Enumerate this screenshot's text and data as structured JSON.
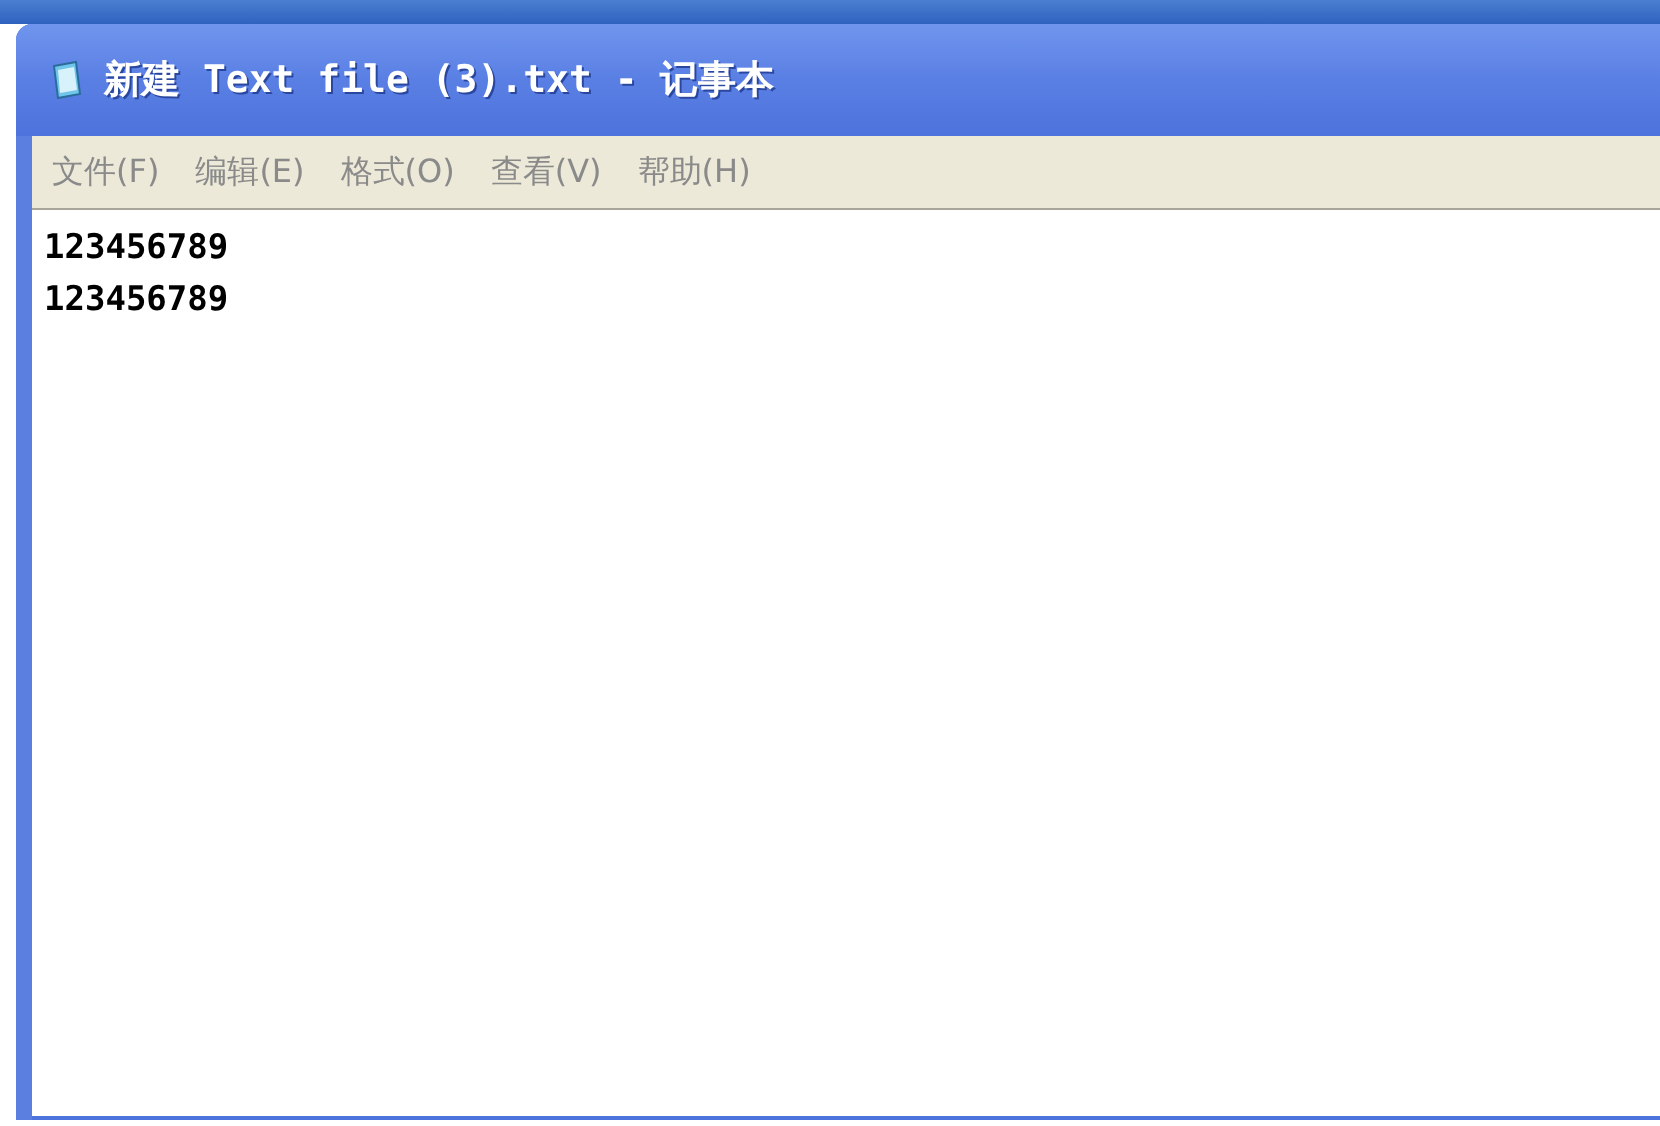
{
  "window": {
    "title": "新建 Text file (3).txt - 记事本"
  },
  "menu": [
    {
      "label": "文件(F)"
    },
    {
      "label": "编辑(E)"
    },
    {
      "label": "格式(O)"
    },
    {
      "label": "查看(V)"
    },
    {
      "label": "帮助(H)"
    }
  ],
  "editor": {
    "lines": [
      "123456789",
      "123456789"
    ]
  }
}
